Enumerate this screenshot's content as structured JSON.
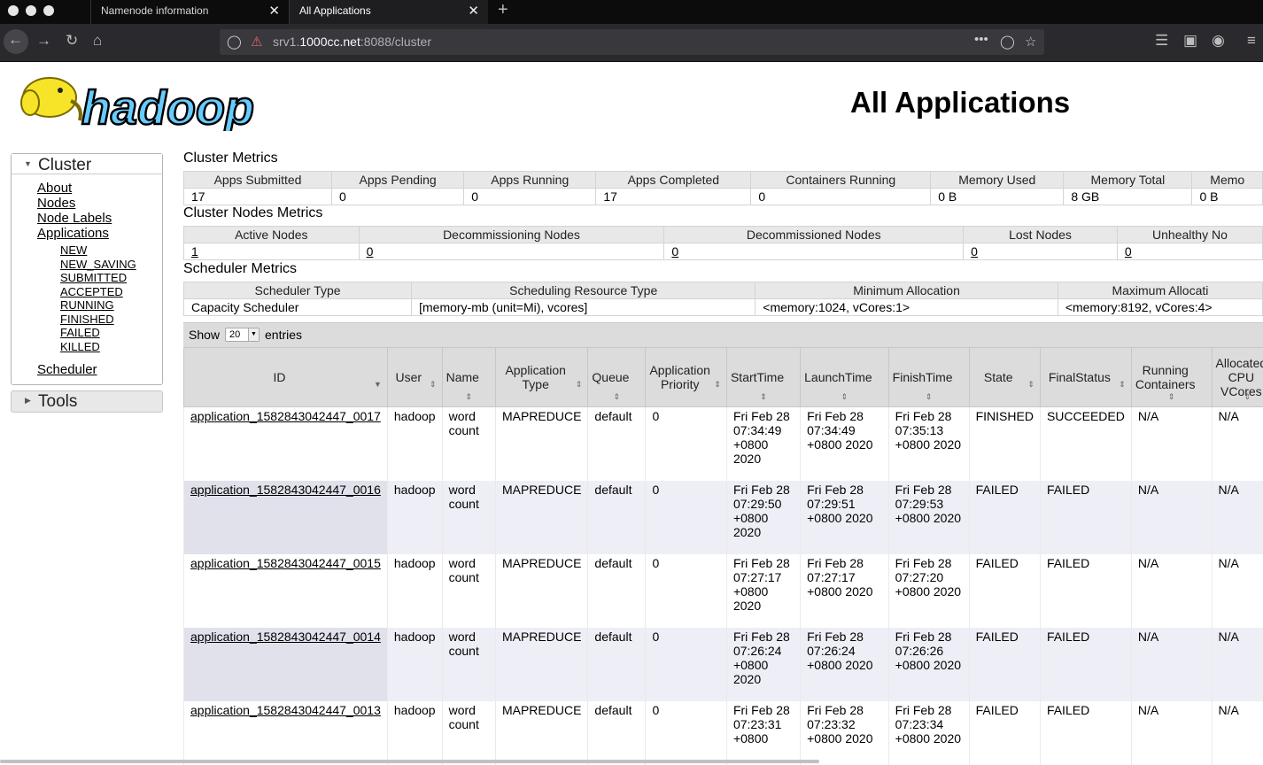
{
  "browser": {
    "tabs": [
      {
        "label": "Namenode information",
        "close": "✕"
      },
      {
        "label": "All Applications",
        "close": "✕"
      }
    ],
    "new_tab": "+",
    "url_prefix": "srv1.",
    "url_host": "1000cc.net",
    "url_rest": ":8088/cluster",
    "overflow_menu": "•••"
  },
  "page": {
    "logo_text": "hadoop",
    "title": "All Applications"
  },
  "nav": {
    "cluster_label": "Cluster",
    "cluster_links": [
      "About",
      "Nodes",
      "Node Labels",
      "Applications"
    ],
    "app_states": [
      "NEW",
      "NEW_SAVING",
      "SUBMITTED",
      "ACCEPTED",
      "RUNNING",
      "FINISHED",
      "FAILED",
      "KILLED"
    ],
    "scheduler_label": "Scheduler",
    "tools_label": "Tools"
  },
  "cluster_metrics": {
    "title": "Cluster Metrics",
    "headers": [
      "Apps Submitted",
      "Apps Pending",
      "Apps Running",
      "Apps Completed",
      "Containers Running",
      "Memory Used",
      "Memory Total",
      "Memo"
    ],
    "values": [
      "17",
      "0",
      "0",
      "17",
      "0",
      "0 B",
      "8 GB",
      "0 B"
    ]
  },
  "node_metrics": {
    "title": "Cluster Nodes Metrics",
    "headers": [
      "Active Nodes",
      "Decommissioning Nodes",
      "Decommissioned Nodes",
      "Lost Nodes",
      "Unhealthy No"
    ],
    "values": [
      "1",
      "0",
      "0",
      "0",
      "0"
    ]
  },
  "scheduler_metrics": {
    "title": "Scheduler Metrics",
    "headers": [
      "Scheduler Type",
      "Scheduling Resource Type",
      "Minimum Allocation",
      "Maximum Allocati"
    ],
    "values": [
      "Capacity Scheduler",
      "[memory-mb (unit=Mi), vcores]",
      "<memory:1024, vCores:1>",
      "<memory:8192, vCores:4>"
    ]
  },
  "table_controls": {
    "show_label": "Show",
    "page_size": "20",
    "entries_label": "entries"
  },
  "apps": {
    "columns": [
      "ID",
      "User",
      "Name",
      "Application Type",
      "Queue",
      "Application Priority",
      "StartTime",
      "LaunchTime",
      "FinishTime",
      "State",
      "FinalStatus",
      "Running Containers",
      "Allocated CPU VCores"
    ],
    "rows": [
      {
        "id": "application_1582843042447_0017",
        "user": "hadoop",
        "name": "word count",
        "type": "MAPREDUCE",
        "queue": "default",
        "priority": "0",
        "start": "Fri Feb 28 07:34:49 +0800 2020",
        "launch": "Fri Feb 28 07:34:49 +0800 2020",
        "finish": "Fri Feb 28 07:35:13 +0800 2020",
        "state": "FINISHED",
        "final_status": "SUCCEEDED",
        "running_containers": "N/A",
        "vcores": "N/A"
      },
      {
        "id": "application_1582843042447_0016",
        "user": "hadoop",
        "name": "word count",
        "type": "MAPREDUCE",
        "queue": "default",
        "priority": "0",
        "start": "Fri Feb 28 07:29:50 +0800 2020",
        "launch": "Fri Feb 28 07:29:51 +0800 2020",
        "finish": "Fri Feb 28 07:29:53 +0800 2020",
        "state": "FAILED",
        "final_status": "FAILED",
        "running_containers": "N/A",
        "vcores": "N/A"
      },
      {
        "id": "application_1582843042447_0015",
        "user": "hadoop",
        "name": "word count",
        "type": "MAPREDUCE",
        "queue": "default",
        "priority": "0",
        "start": "Fri Feb 28 07:27:17 +0800 2020",
        "launch": "Fri Feb 28 07:27:17 +0800 2020",
        "finish": "Fri Feb 28 07:27:20 +0800 2020",
        "state": "FAILED",
        "final_status": "FAILED",
        "running_containers": "N/A",
        "vcores": "N/A"
      },
      {
        "id": "application_1582843042447_0014",
        "user": "hadoop",
        "name": "word count",
        "type": "MAPREDUCE",
        "queue": "default",
        "priority": "0",
        "start": "Fri Feb 28 07:26:24 +0800 2020",
        "launch": "Fri Feb 28 07:26:24 +0800 2020",
        "finish": "Fri Feb 28 07:26:26 +0800 2020",
        "state": "FAILED",
        "final_status": "FAILED",
        "running_containers": "N/A",
        "vcores": "N/A"
      },
      {
        "id": "application_1582843042447_0013",
        "user": "hadoop",
        "name": "word count",
        "type": "MAPREDUCE",
        "queue": "default",
        "priority": "0",
        "start": "Fri Feb 28 07:23:31 +0800",
        "launch": "Fri Feb 28 07:23:32 +0800 2020",
        "finish": "Fri Feb 28 07:23:34 +0800 2020",
        "state": "FAILED",
        "final_status": "FAILED",
        "running_containers": "N/A",
        "vcores": "N/A"
      }
    ]
  },
  "colors": {
    "chrome_dark": "#0c0c0d",
    "toolbar": "#2a2a2e",
    "header_bg": "#e8e8e8",
    "row_even": "#eeeef6",
    "logo_yellow": "#f7e328",
    "logo_blue": "#66ccff"
  },
  "icons": [
    "back-icon",
    "forward-icon",
    "reload-icon",
    "home-icon",
    "shield-icon",
    "insecure-lock-icon",
    "pocket-icon",
    "bookmark-star-icon",
    "library-icon",
    "sidebar-icon",
    "account-icon",
    "menu-icon",
    "sort-icon"
  ]
}
